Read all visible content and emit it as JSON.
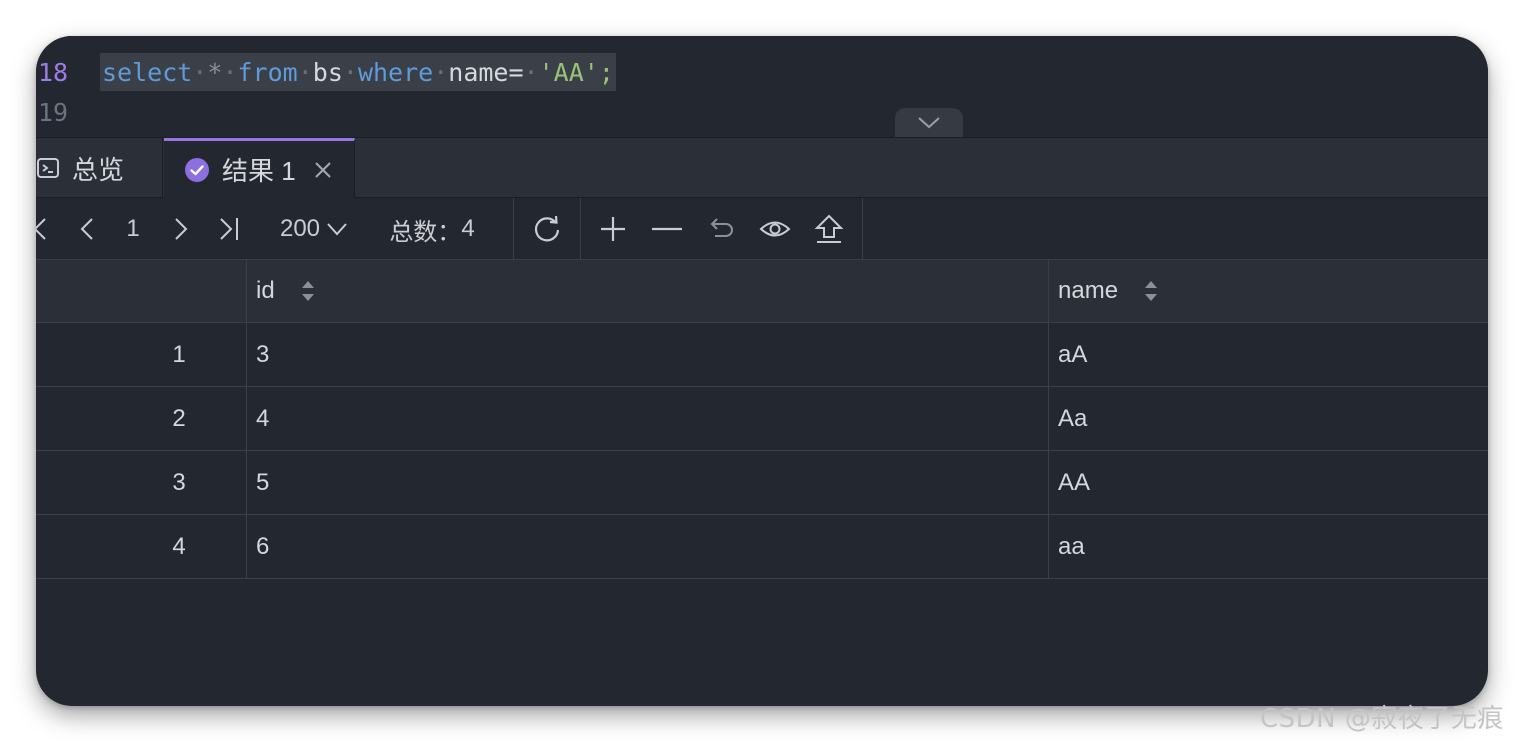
{
  "editor": {
    "lines": [
      {
        "number": "18",
        "tokens": [
          "select",
          "*",
          "from",
          "bs",
          "where",
          "name=",
          "'AA';"
        ]
      },
      {
        "number": "19"
      }
    ]
  },
  "tabs": [
    {
      "label": "总览",
      "icon": "console-icon"
    },
    {
      "label": "结果 1",
      "icon": "check-circle-icon",
      "active": true
    }
  ],
  "toolbar": {
    "page": "1",
    "page_size": "200",
    "total_label": "总数：",
    "total_count": "4"
  },
  "grid": {
    "columns": [
      "id",
      "name"
    ],
    "rows": [
      {
        "n": "1",
        "id": "3",
        "name": "aA"
      },
      {
        "n": "2",
        "id": "4",
        "name": "Aa"
      },
      {
        "n": "3",
        "id": "5",
        "name": "AA"
      },
      {
        "n": "4",
        "id": "6",
        "name": "aa"
      }
    ]
  },
  "colors": {
    "accent": "#9575e8",
    "keyword": "#5e9bd8",
    "string": "#98c379",
    "background": "#23272f"
  },
  "watermark": "CSDN @寂夜了无痕"
}
